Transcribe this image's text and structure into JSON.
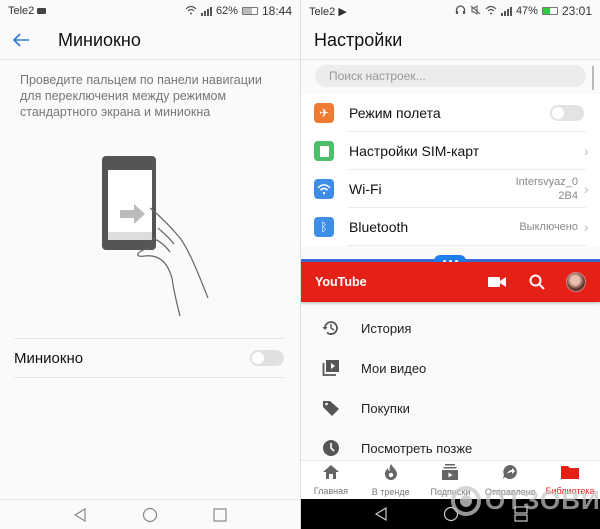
{
  "left": {
    "statusbar": {
      "carrier": "Tele2",
      "battery": "62%",
      "battery_level": 0.62,
      "time": "18:44"
    },
    "header": {
      "title": "Миниокно"
    },
    "description": "Проведите пальцем по панели навигации для переключения между режимом стандартного экрана и миниокна",
    "toggle": {
      "label": "Миниокно",
      "on": false
    },
    "navbar": {
      "back": "back-icon",
      "home": "home-icon",
      "recents": "recents-icon"
    }
  },
  "right": {
    "statusbar": {
      "carrier": "Tele2",
      "battery": "47%",
      "battery_level": 0.47,
      "time": "23:01"
    },
    "header": {
      "title": "Настройки"
    },
    "search": {
      "placeholder": "Поиск настроек..."
    },
    "settings": [
      {
        "label": "Режим полета",
        "icon": "airplane-icon",
        "color": "#ef7a32",
        "type": "toggle",
        "on": false
      },
      {
        "label": "Настройки SIM-карт",
        "icon": "sim-card-icon",
        "color": "#4cbf6b",
        "type": "chevron"
      },
      {
        "label": "Wi-Fi",
        "icon": "wifi-icon",
        "color": "#3e8ee6",
        "type": "value",
        "value_line1": "Intersvyaz_0",
        "value_line2": "2B4"
      },
      {
        "label": "Bluetooth",
        "icon": "bluetooth-icon",
        "color": "#3e8ee6",
        "type": "value",
        "value_line1": "Выключено"
      }
    ],
    "youtube": {
      "title": "YouTube",
      "accent": "#e52117",
      "menu": [
        {
          "label": "История",
          "icon": "history-icon"
        },
        {
          "label": "Мои видео",
          "icon": "my-videos-icon"
        },
        {
          "label": "Покупки",
          "icon": "purchases-tag-icon"
        },
        {
          "label": "Посмотреть позже",
          "icon": "watch-later-icon"
        }
      ],
      "tabs": [
        {
          "label": "Главная",
          "icon": "home-icon",
          "active": false
        },
        {
          "label": "В тренде",
          "icon": "trending-flame-icon",
          "active": false
        },
        {
          "label": "Подписки",
          "icon": "subscriptions-icon",
          "active": false
        },
        {
          "label": "Отправлено",
          "icon": "shared-icon",
          "active": false
        },
        {
          "label": "Библиотека",
          "icon": "library-folder-icon",
          "active": true
        }
      ]
    },
    "watermark": "ОТЗОВИК"
  }
}
